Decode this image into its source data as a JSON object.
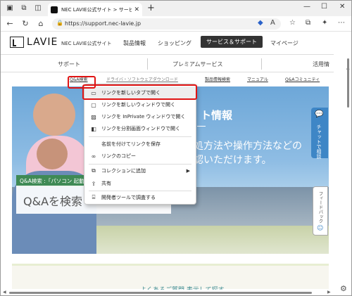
{
  "browser": {
    "tab_title": "NEC LAVIE公式サイト > サービス＆サ",
    "url": "https://support.nec-lavie.jp"
  },
  "site": {
    "logo_text": "LAVIE",
    "site_name": "NEC LAVIE公式サイト",
    "nav": [
      "製品情報",
      "ショッピング",
      "サービス＆サポート",
      "マイページ"
    ],
    "subnav": [
      "サポート",
      "プレミアムサービス",
      "活用情"
    ],
    "links": [
      "Q&A検索",
      "ドライバ・ソフトウェアダウンロード",
      "製品情報検索",
      "マニュアル",
      "Q&Aコミュニティ"
    ]
  },
  "hero": {
    "title": "ト情報",
    "sub1": "処方法や操作方法などの",
    "sub2": "認いただけます。",
    "qa_label": "Q&A検索 :「パソコン 起動",
    "qa_placeholder": "Q&Aを検索",
    "below_text": "よくあるご質問 表示して探す"
  },
  "side": {
    "chat": "チャットで相談",
    "feedback": "フィードバック"
  },
  "context_menu": {
    "items": [
      {
        "label": "リンクを新しいタブで開く",
        "icon": "new-tab-icon"
      },
      {
        "label": "リンクを新しいウィンドウで開く",
        "icon": "new-window-icon"
      },
      {
        "label": "リンクを InPrivate ウィンドウで開く",
        "icon": "inprivate-icon"
      },
      {
        "label": "リンクを分割画面ウィンドウで開く",
        "icon": "split-screen-icon"
      },
      {
        "label": "名前を付けてリンクを保存",
        "icon": ""
      },
      {
        "label": "リンクのコピー",
        "icon": "link-icon"
      },
      {
        "label": "コレクションに追加",
        "icon": "collections-icon"
      },
      {
        "label": "共有",
        "icon": "share-icon"
      },
      {
        "label": "開発者ツールで調査する",
        "icon": "devtools-icon"
      }
    ]
  },
  "colors": {
    "highlight_box": "#e01414",
    "chat_bg": "#3e86c6",
    "qa_label_bg": "#3f8a55"
  }
}
